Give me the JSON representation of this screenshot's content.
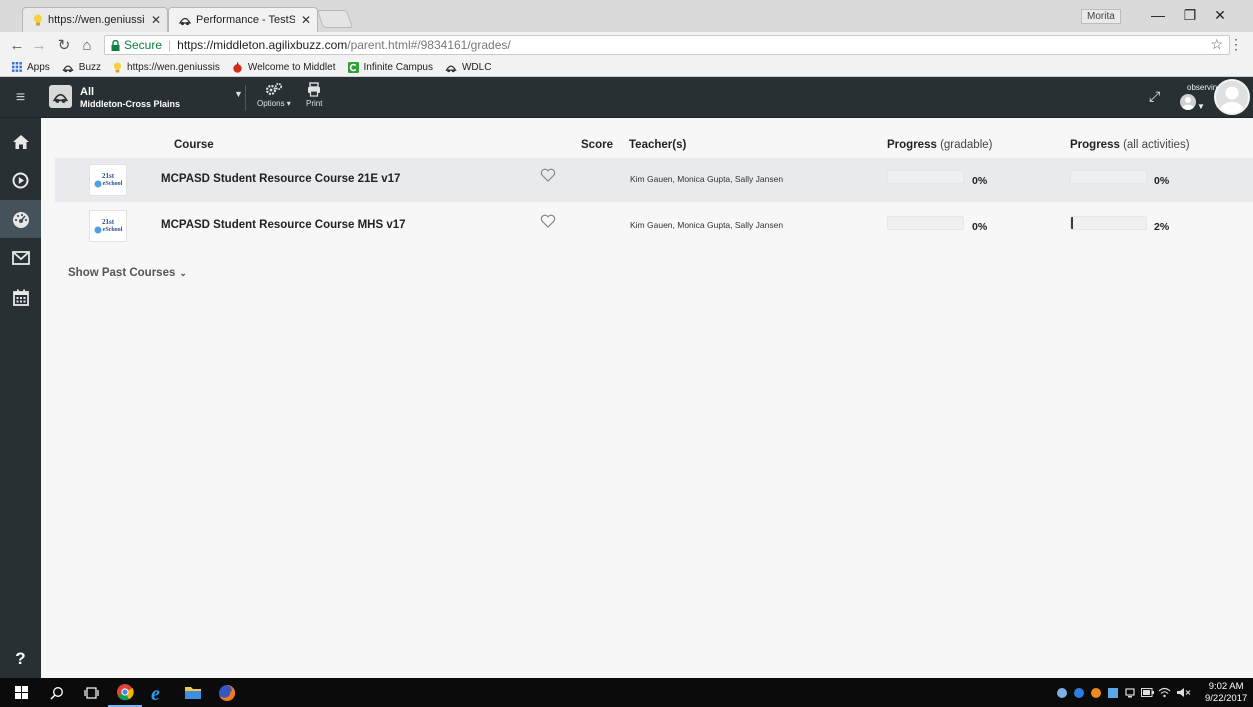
{
  "browser": {
    "tabs": [
      {
        "title": "https://wen.geniussis.co"
      },
      {
        "title": "Performance - TestStude"
      }
    ],
    "profile_name": "Morita",
    "address": {
      "secure_label": "Secure",
      "url_host": "https://middleton.agilixbuzz.com",
      "url_path": "/parent.html#/9834161/grades/"
    },
    "bookmarks": [
      {
        "label": "Apps",
        "icon": "apps-grid-icon"
      },
      {
        "label": "Buzz",
        "icon": "buzz-icon"
      },
      {
        "label": "https://wen.geniussis",
        "icon": "bulb-icon"
      },
      {
        "label": "Welcome to Middlet",
        "icon": "apple-icon"
      },
      {
        "label": "Infinite Campus",
        "icon": "campus-icon"
      },
      {
        "label": "WDLC",
        "icon": "buzz-icon"
      }
    ]
  },
  "header": {
    "domain_name": "All",
    "domain_sub": "Middleton-Cross Plains",
    "options_label": "Options",
    "print_label": "Print",
    "observing_label": "observing:"
  },
  "table": {
    "headers": {
      "course": "Course",
      "score": "Score",
      "teachers": "Teacher(s)",
      "progress_gradable": "Progress",
      "progress_gradable_sub": "(gradable)",
      "progress_all": "Progress",
      "progress_all_sub": "(all activities)"
    },
    "rows": [
      {
        "thumb_line1": "21st",
        "thumb_line2": "eSchool",
        "title": "MCPASD Student Resource Course 21E v17",
        "teachers": "Kim Gauen, Monica Gupta, Sally Jansen",
        "progress_gradable": "0%",
        "progress_gradable_value": 0,
        "progress_all": "0%",
        "progress_all_value": 0
      },
      {
        "thumb_line1": "21st",
        "thumb_line2": "eSchool",
        "title": "MCPASD Student Resource Course MHS v17",
        "teachers": "Kim Gauen, Monica Gupta, Sally Jansen",
        "progress_gradable": "0%",
        "progress_gradable_value": 0,
        "progress_all": "2%",
        "progress_all_value": 2
      }
    ],
    "show_past_label": "Show Past Courses"
  },
  "taskbar": {
    "time": "9:02 AM",
    "date": "9/22/2017"
  },
  "colors": {
    "header_bg": "#283033",
    "row_highlight": "#e8eaed",
    "secure_green": "#0b8043"
  }
}
